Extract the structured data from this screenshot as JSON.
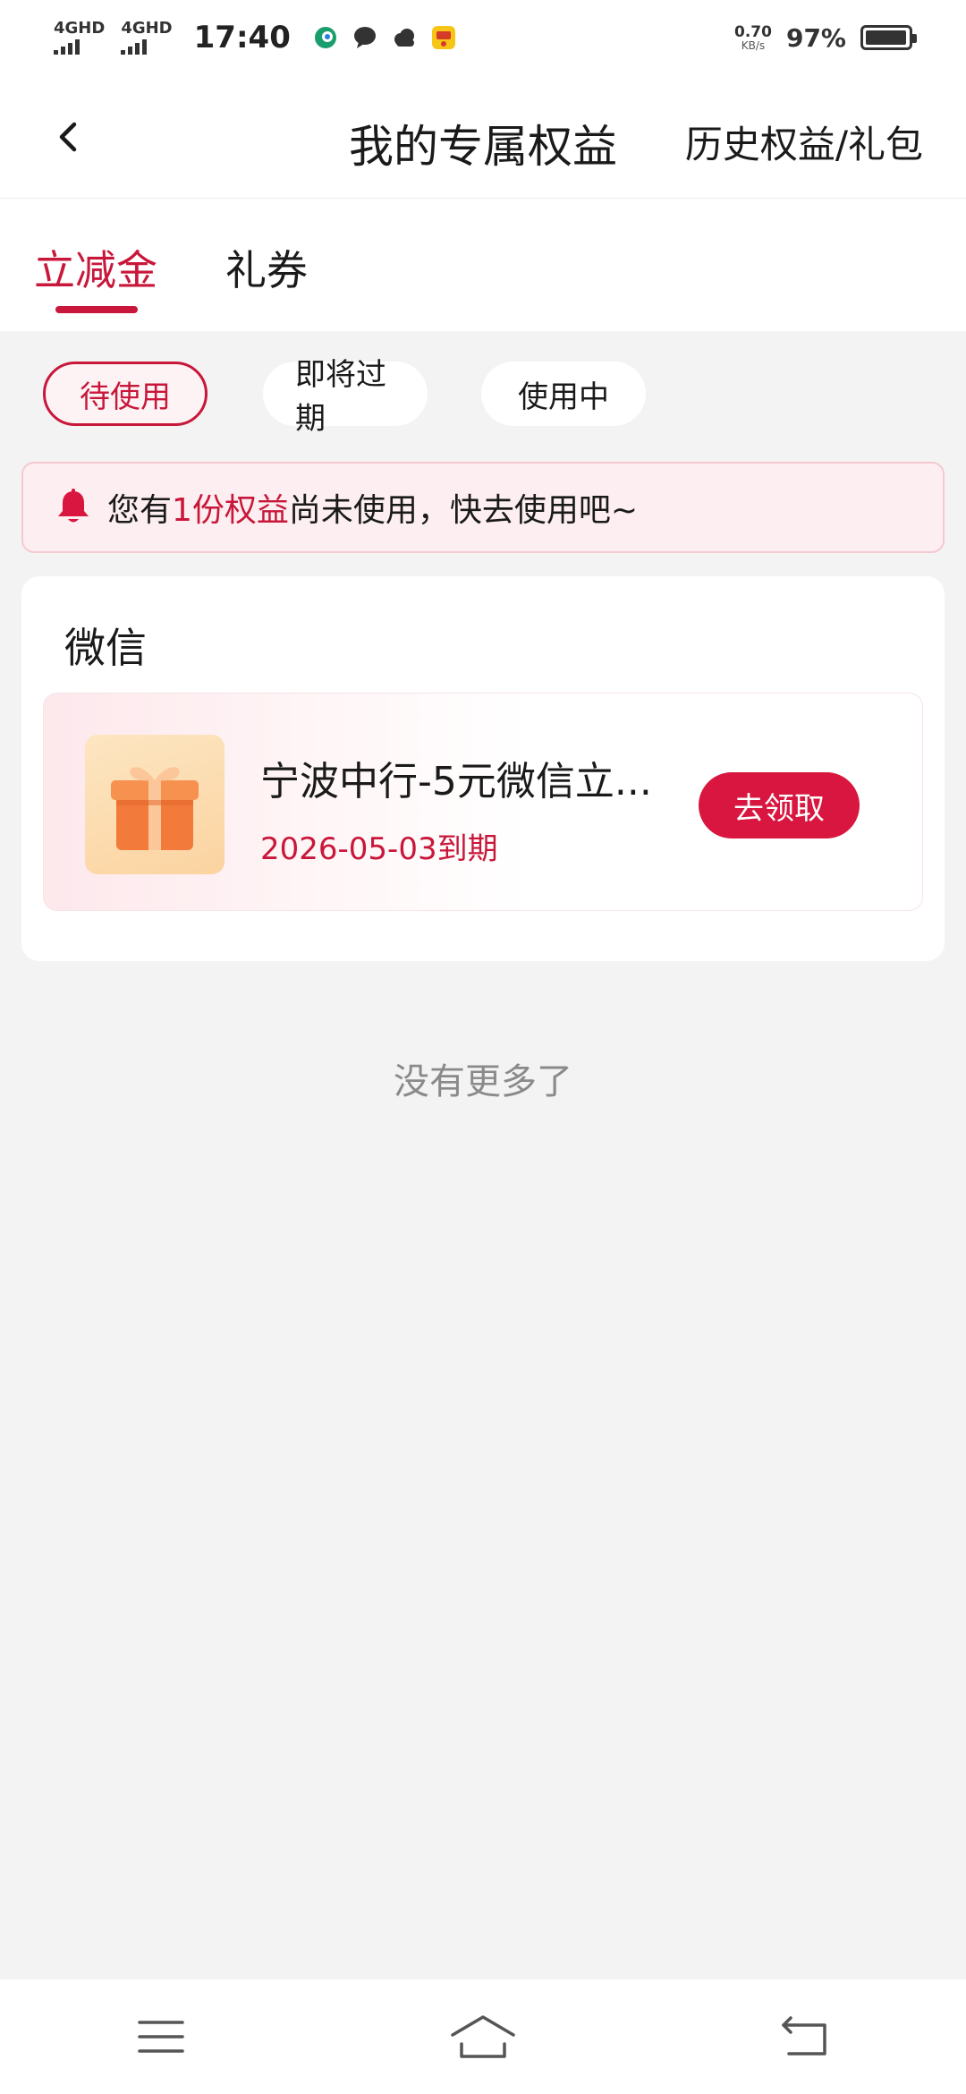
{
  "status_bar": {
    "network1": "4GHD",
    "network2": "4GHD",
    "time": "17:40",
    "speed_value": "0.70",
    "speed_unit": "KB/s",
    "battery": "97%",
    "battery_level": 0.97
  },
  "header": {
    "title": "我的专属权益",
    "history_link": "历史权益/礼包"
  },
  "tabs": [
    {
      "label": "立减金",
      "active": true
    },
    {
      "label": "礼券",
      "active": false
    }
  ],
  "filters": [
    {
      "label": "待使用",
      "active": true
    },
    {
      "label": "即将过期",
      "active": false
    },
    {
      "label": "使用中",
      "active": false
    }
  ],
  "notice": {
    "prefix": "您有",
    "highlight": "1份权益",
    "suffix": "尚未使用，快去使用吧~"
  },
  "group": {
    "title": "微信",
    "coupon": {
      "name": "宁波中行-5元微信立...",
      "expiry": "2026-05-03到期",
      "button": "去领取"
    }
  },
  "footer_text": "没有更多了",
  "colors": {
    "accent": "#c8173a",
    "button": "#d8163f",
    "background": "#f3f3f3"
  }
}
